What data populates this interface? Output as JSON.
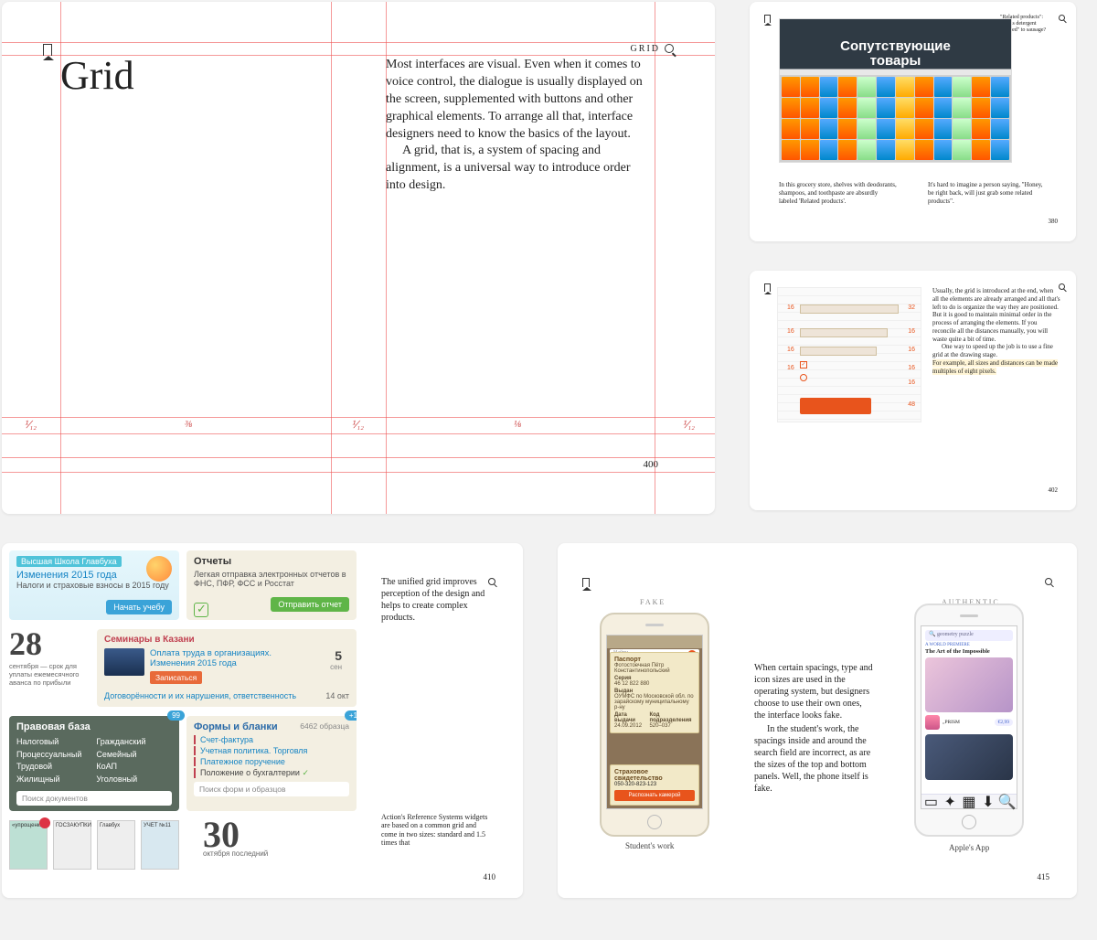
{
  "main": {
    "running_head": "GRID",
    "title": "Grid",
    "para1": "Most interfaces are visual. Even when it comes to voice control, the dialogue is usually displayed on the screen, supplemented with buttons and other graphical elements. To arrange all that, interface designers need to know the basics of the layout.",
    "para2": "A grid, that is, a system of spacing and alignment, is a universal way to introduce order into design.",
    "page_number": "400",
    "fractions": [
      "⅟₁₂",
      "⅜",
      "⅟₁₂",
      "⅛",
      "⅟₁₂"
    ]
  },
  "tr1": {
    "sign_line1": "Сопутствующие",
    "sign_line2": "товары",
    "sidenote": "\"Related products\": how is detergent \"related\" to sausage?",
    "caption_a": "In this grocery store, shelves with deodorants, shampoos, and toothpaste are absurdly labeled 'Related products'.",
    "caption_b": "It's hard to imagine a person saying, \"Honey, be right back, will just grab some related products\".",
    "page_number": "380"
  },
  "tr2": {
    "para": "Usually, the grid is introduced at the end, when all the elements are already arranged and all that's left to do is organize the way they are positioned. But it is good to maintain minimal order in the process of arranging the elements. If you reconcile all the distances manually, you will waste quite a bit of time.",
    "para_indent": "One way to speed up the job is to use a fine grid at the drawing stage.",
    "highlight": "For example, all sizes and distances can be made multiples of eight pixels.",
    "numbers_left": [
      "16",
      "16",
      "16",
      "16"
    ],
    "numbers_right": [
      "32",
      "16",
      "16",
      "16",
      "16",
      "48"
    ],
    "page_number": "402"
  },
  "bl": {
    "commentary": "The unified grid improves perception of the design and helps to create complex products.",
    "commentary2": "Action's Reference Systems widgets are based on a common grid and come in two sizes: standard and 1.5 times that",
    "page_number": "410",
    "school": {
      "tag": "Высшая Школа Главбуха",
      "link": "Изменения 2015 года",
      "sub": "Налоги и страховые взносы в 2015 году",
      "btn": "Начать учебу"
    },
    "reports": {
      "title": "Отчеты",
      "desc": "Легкая отправка электронных отчетов в ФНС, ПФР, ФСС и Росстат",
      "btn": "Отправить отчет"
    },
    "date28": {
      "num": "28",
      "label": "сентября — срок для уплаты ежемесячного аванса по прибыли"
    },
    "seminar": {
      "title": "Семинары в Казани",
      "item_line1": "Оплата труда в организациях.",
      "item_line2": "Изменения 2015 года",
      "btn": "Записаться",
      "date_num": "5",
      "date_label": "сен",
      "line2": "Договорённости и их нарушения, ответственность",
      "line2_date": "14 окт"
    },
    "legal": {
      "title": "Правовая база",
      "badge": "99",
      "col1": [
        "Налоговый",
        "Процессуальный",
        "Трудовой",
        "Жилищный"
      ],
      "col2": [
        "Гражданский",
        "Семейный",
        "КоАП",
        "Уголовный"
      ],
      "search_placeholder": "Поиск документов"
    },
    "forms": {
      "title": "Формы и бланки",
      "count": "6462 образца",
      "badge": "+1",
      "items": [
        "Счет-фактура",
        "Учетная политика. Торговля",
        "Платежное поручение",
        "Положение о бухгалтерии"
      ],
      "search_placeholder": "Поиск форм и образцов"
    },
    "covers": [
      "«упрощенка»",
      "ГОСЗАКУПКИ",
      "Главбух",
      "УЧЕТ №11"
    ],
    "date30": {
      "num": "30",
      "label": "октября последний"
    }
  },
  "br": {
    "label_fake": "FAKE",
    "label_auth": "AUTHENTIC",
    "cap_fake": "Student's work",
    "cap_auth": "Apple's App",
    "commentary1": "When certain spacings, type and icon sizes are used in the operating system, but designers choose to use their own ones, the interface looks fake.",
    "commentary2": "In the student's work, the spacings inside and around the search field are incorrect, as are the sizes of the top and bottom panels. Well, the phone itself is fake.",
    "page_number": "415",
    "fake_phone": {
      "search_placeholder": "Найти",
      "passport_title": "Паспорт",
      "name": "Фотостоечная Пётр Константинопольский",
      "series_label": "Серия",
      "series": "46 12 822 880",
      "issued_label": "Выдан",
      "issued": "ОУМФС по Московской обл. по зарайскому муниципальному р-ну",
      "date_label": "Дата выдачи",
      "date": "24.09.2012",
      "code_label": "Код подразделения",
      "code": "520–037",
      "sv_title": "Страховое свидетельство",
      "sv_num": "050-320-823-123",
      "sv_btn": "Распознать камерой"
    },
    "auth_phone": {
      "search": "geometry puzzle",
      "hero_title": "The Art of the Impossible",
      "section": "A WORLD PREMIERE",
      "app_name": "„PRISM",
      "price": "€2,99"
    }
  }
}
